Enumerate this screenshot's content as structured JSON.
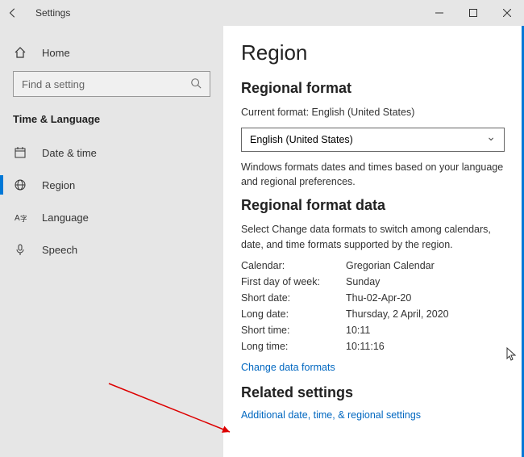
{
  "titlebar": {
    "title": "Settings"
  },
  "sidebar": {
    "home_label": "Home",
    "search_placeholder": "Find a setting",
    "category_label": "Time & Language",
    "items": [
      {
        "label": "Date & time"
      },
      {
        "label": "Region"
      },
      {
        "label": "Language"
      },
      {
        "label": "Speech"
      }
    ]
  },
  "content": {
    "page_title": "Region",
    "section1_title": "Regional format",
    "current_format_label": "Current format: English (United States)",
    "dropdown_value": "English (United States)",
    "format_note": "Windows formats dates and times based on your language and regional preferences.",
    "section2_title": "Regional format data",
    "section2_desc": "Select Change data formats to switch among calendars, date, and time formats supported by the region.",
    "rows": {
      "calendar_label": "Calendar:",
      "calendar_value": "Gregorian Calendar",
      "fdow_label": "First day of week:",
      "fdow_value": "Sunday",
      "sdate_label": "Short date:",
      "sdate_value": "Thu-02-Apr-20",
      "ldate_label": "Long date:",
      "ldate_value": "Thursday, 2 April, 2020",
      "stime_label": "Short time:",
      "stime_value": "10:11",
      "ltime_label": "Long time:",
      "ltime_value": "10:11:16"
    },
    "change_link": "Change data formats",
    "section3_title": "Related settings",
    "additional_link": "Additional date, time, & regional settings"
  }
}
